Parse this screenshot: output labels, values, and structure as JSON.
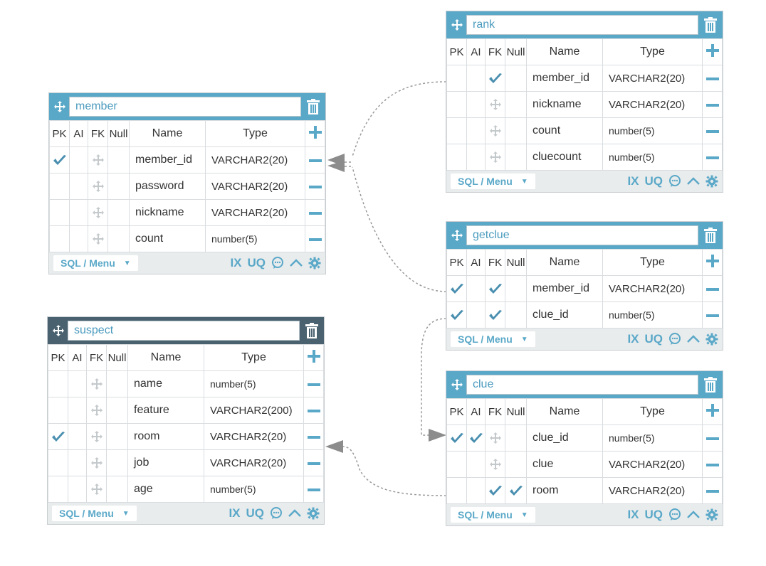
{
  "colors": {
    "header_blue": "#5aa8c8",
    "header_dark": "#4a6270",
    "accent": "#5aa8c8",
    "check": "#4a8fb0"
  },
  "columns": [
    "PK",
    "AI",
    "FK",
    "Null",
    "Name",
    "Type"
  ],
  "footer": {
    "sql_menu": "SQL / Menu",
    "ix": "IX",
    "uq": "UQ"
  },
  "tables": [
    {
      "id": "member",
      "title": "member",
      "header": "blue",
      "rows": [
        {
          "pk": true,
          "ai": false,
          "fk": false,
          "null": false,
          "name": "member_id",
          "type": "VARCHAR2(20)"
        },
        {
          "pk": false,
          "ai": false,
          "fk": false,
          "null": false,
          "name": "password",
          "type": "VARCHAR2(20)"
        },
        {
          "pk": false,
          "ai": false,
          "fk": false,
          "null": false,
          "name": "nickname",
          "type": "VARCHAR2(20)"
        },
        {
          "pk": false,
          "ai": false,
          "fk": false,
          "null": false,
          "name": "count",
          "type": "number(5)"
        }
      ]
    },
    {
      "id": "suspect",
      "title": "suspect",
      "header": "dark",
      "rows": [
        {
          "pk": false,
          "ai": false,
          "fk": false,
          "null": false,
          "name": "name",
          "type": "number(5)"
        },
        {
          "pk": false,
          "ai": false,
          "fk": false,
          "null": false,
          "name": "feature",
          "type": "VARCHAR2(200)"
        },
        {
          "pk": true,
          "ai": false,
          "fk": false,
          "null": false,
          "name": "room",
          "type": "VARCHAR2(20)"
        },
        {
          "pk": false,
          "ai": false,
          "fk": false,
          "null": false,
          "name": "job",
          "type": "VARCHAR2(20)"
        },
        {
          "pk": false,
          "ai": false,
          "fk": false,
          "null": false,
          "name": "age",
          "type": "number(5)"
        }
      ]
    },
    {
      "id": "rank",
      "title": "rank",
      "header": "blue",
      "rows": [
        {
          "pk": false,
          "ai": false,
          "fk": true,
          "null": false,
          "name": "member_id",
          "type": "VARCHAR2(20)"
        },
        {
          "pk": false,
          "ai": false,
          "fk": false,
          "null": false,
          "name": "nickname",
          "type": "VARCHAR2(20)"
        },
        {
          "pk": false,
          "ai": false,
          "fk": false,
          "null": false,
          "name": "count",
          "type": "number(5)"
        },
        {
          "pk": false,
          "ai": false,
          "fk": false,
          "null": false,
          "name": "cluecount",
          "type": "number(5)"
        }
      ]
    },
    {
      "id": "getclue",
      "title": "getclue",
      "header": "blue",
      "rows": [
        {
          "pk": true,
          "ai": false,
          "fk": true,
          "null": false,
          "name": "member_id",
          "type": "VARCHAR2(20)"
        },
        {
          "pk": true,
          "ai": false,
          "fk": true,
          "null": false,
          "name": "clue_id",
          "type": "number(5)"
        }
      ]
    },
    {
      "id": "clue",
      "title": "clue",
      "header": "blue",
      "rows": [
        {
          "pk": true,
          "ai": true,
          "fk": false,
          "null": false,
          "name": "clue_id",
          "type": "number(5)"
        },
        {
          "pk": false,
          "ai": false,
          "fk": false,
          "null": false,
          "name": "clue",
          "type": "VARCHAR2(20)"
        },
        {
          "pk": false,
          "ai": false,
          "fk": true,
          "null": true,
          "name": "room",
          "type": "VARCHAR2(20)"
        }
      ]
    }
  ]
}
